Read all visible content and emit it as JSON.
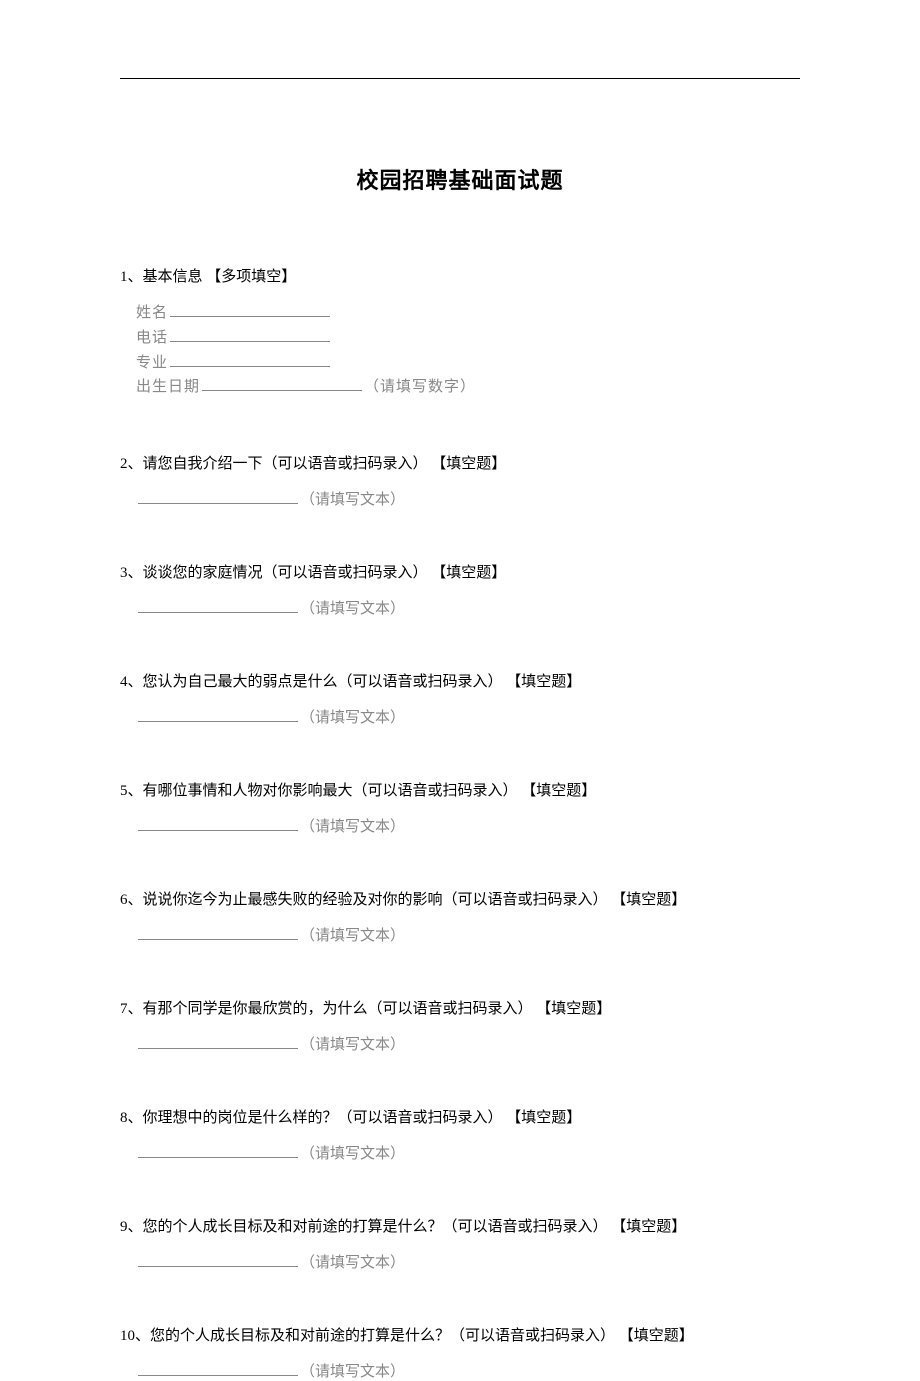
{
  "document": {
    "title": "校园招聘基础面试题"
  },
  "q1": {
    "title": "1、基本信息 【多项填空】",
    "fields": {
      "name": "姓名",
      "phone": "电话",
      "major": "专业",
      "birth": "出生日期",
      "birth_hint": "（请填写数字）"
    }
  },
  "q2": {
    "title": "2、请您自我介绍一下（可以语音或扫码录入） 【填空题】",
    "hint": "（请填写文本）"
  },
  "q3": {
    "title": "3、谈谈您的家庭情况（可以语音或扫码录入） 【填空题】",
    "hint": "（请填写文本）"
  },
  "q4": {
    "title": "4、您认为自己最大的弱点是什么（可以语音或扫码录入） 【填空题】",
    "hint": "（请填写文本）"
  },
  "q5": {
    "title": "5、有哪位事情和人物对你影响最大（可以语音或扫码录入） 【填空题】",
    "hint": "（请填写文本）"
  },
  "q6": {
    "title": "6、说说你迄今为止最感失败的经验及对你的影响（可以语音或扫码录入） 【填空题】",
    "hint": "（请填写文本）"
  },
  "q7": {
    "title": "7、有那个同学是你最欣赏的，为什么（可以语音或扫码录入） 【填空题】",
    "hint": "（请填写文本）"
  },
  "q8": {
    "title": "8、你理想中的岗位是什么样的？（可以语音或扫码录入） 【填空题】",
    "hint": "（请填写文本）"
  },
  "q9": {
    "title": "9、您的个人成长目标及和对前途的打算是什么？（可以语音或扫码录入） 【填空题】",
    "hint": "（请填写文本）"
  },
  "q10": {
    "title": "10、您的个人成长目标及和对前途的打算是什么？（可以语音或扫码录入） 【填空题】",
    "hint": "（请填写文本）"
  }
}
